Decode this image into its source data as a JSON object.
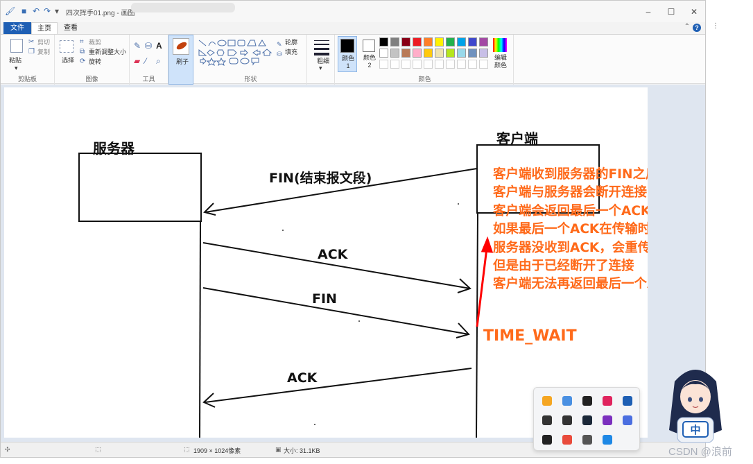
{
  "window": {
    "title": "四次挥手01.png - 画图"
  },
  "menu": {
    "tabs": [
      "文件",
      "主页",
      "查看"
    ]
  },
  "ribbon": {
    "clipboard": {
      "paste": "粘贴",
      "cut": "剪切",
      "copy": "复制",
      "label": "剪贴板"
    },
    "image": {
      "select": "选择",
      "crop": "裁剪",
      "resize": "重新调整大小",
      "rotate": "旋转",
      "label": "图像"
    },
    "tools": {
      "label": "工具"
    },
    "brushes": {
      "label": "刷子"
    },
    "shapes": {
      "outline": "轮廓",
      "fill": "填充",
      "label": "形状"
    },
    "size": {
      "label": "粗细"
    },
    "colors": {
      "color1": "颜色 1",
      "color2": "颜色 2",
      "edit": "编辑颜色",
      "label": "颜色",
      "palette_row1": [
        "#000000",
        "#7f7f7f",
        "#880015",
        "#ed1c24",
        "#ff7f27",
        "#fff200",
        "#22b14c",
        "#00a2e8",
        "#3f48cc",
        "#a349a4"
      ],
      "palette_row2": [
        "#ffffff",
        "#c3c3c3",
        "#b97a57",
        "#ffaec9",
        "#ffc90e",
        "#efe4b0",
        "#b5e61d",
        "#99d9ea",
        "#7092be",
        "#c8bfe7"
      ]
    }
  },
  "diagram": {
    "server_label": "服务器",
    "client_label": "客户端",
    "messages": [
      "FIN(结束报文段)",
      "ACK",
      "FIN",
      "ACK"
    ],
    "note_lines": [
      "客户端收到服务器的FIN之后",
      "客户端与服务器会断开连接",
      "客户端会返回最后一个ACK",
      "如果最后一个ACK在传输时丢包了",
      "服务器没收到ACK，会重传FIN",
      "但是由于已经断开了连接",
      "客户端无法再返回最后一个ACK"
    ],
    "time_wait": "TIME_WAIT",
    "note_color": "#ff6a1a",
    "arrow_color": "#ff0000"
  },
  "status": {
    "dimensions": "1909 × 1024像素",
    "size": "大小: 31.1KB"
  },
  "overlay": {
    "ime": "中",
    "watermark": "CSDN @浪前"
  }
}
